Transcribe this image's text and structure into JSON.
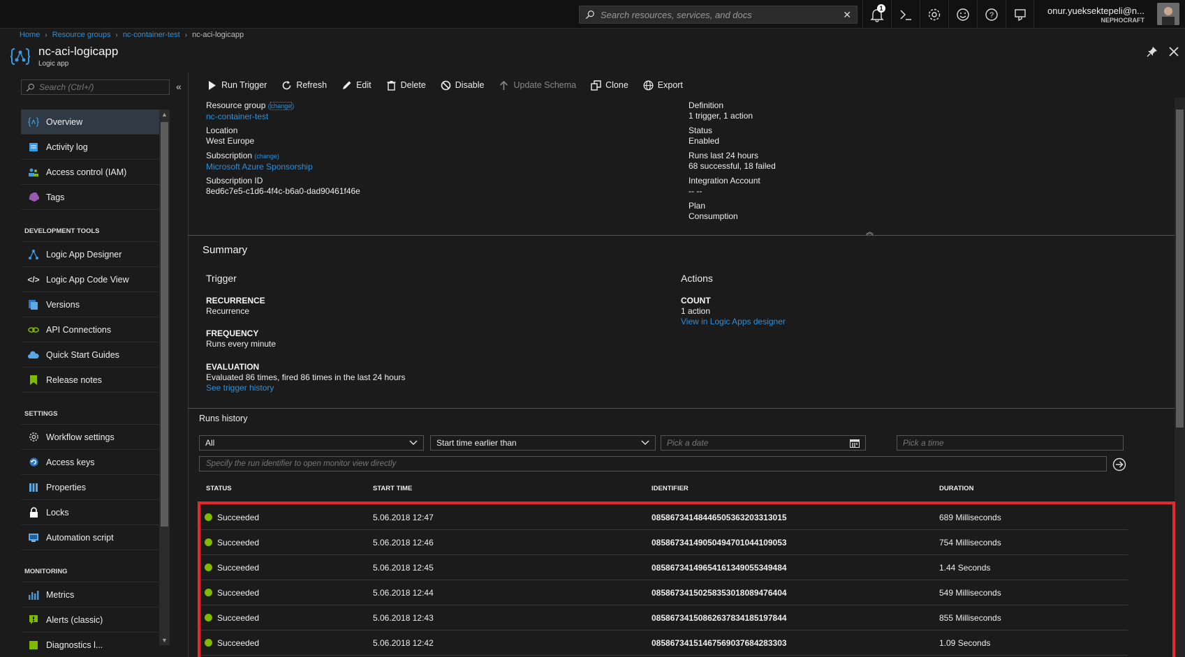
{
  "topbar": {
    "search_placeholder": "Search resources, services, and docs",
    "notification_count": "1",
    "user_name": "onur.yueksektepeli@n...",
    "user_org": "NEPHOCRAFT"
  },
  "breadcrumb": [
    "Home",
    "Resource groups",
    "nc-container-test",
    "nc-aci-logicapp"
  ],
  "blade": {
    "title": "nc-aci-logicapp",
    "subtitle": "Logic app"
  },
  "sidebar": {
    "search_placeholder": "Search (Ctrl+/)",
    "items": [
      {
        "label": "Overview",
        "icon": "logic-app-icon"
      },
      {
        "label": "Activity log",
        "icon": "activity-log-icon"
      },
      {
        "label": "Access control (IAM)",
        "icon": "iam-icon"
      },
      {
        "label": "Tags",
        "icon": "tag-icon"
      }
    ],
    "section_dev": "DEVELOPMENT TOOLS",
    "dev_items": [
      {
        "label": "Logic App Designer",
        "icon": "designer-icon"
      },
      {
        "label": "Logic App Code View",
        "icon": "code-icon"
      },
      {
        "label": "Versions",
        "icon": "versions-icon"
      },
      {
        "label": "API Connections",
        "icon": "api-connections-icon"
      },
      {
        "label": "Quick Start Guides",
        "icon": "cloud-icon"
      },
      {
        "label": "Release notes",
        "icon": "bookmark-icon"
      }
    ],
    "section_settings": "SETTINGS",
    "settings_items": [
      {
        "label": "Workflow settings",
        "icon": "gear-icon"
      },
      {
        "label": "Access keys",
        "icon": "key-icon"
      },
      {
        "label": "Properties",
        "icon": "properties-icon"
      },
      {
        "label": "Locks",
        "icon": "lock-icon"
      },
      {
        "label": "Automation script",
        "icon": "script-icon"
      }
    ],
    "section_monitoring": "MONITORING",
    "monitoring_items": [
      {
        "label": "Metrics",
        "icon": "metrics-icon"
      },
      {
        "label": "Alerts (classic)",
        "icon": "alert-icon"
      },
      {
        "label": "Diagnostics l...",
        "icon": "diagnostics-icon"
      }
    ]
  },
  "commands": {
    "run_trigger": "Run Trigger",
    "refresh": "Refresh",
    "edit": "Edit",
    "delete": "Delete",
    "disable": "Disable",
    "update_schema": "Update Schema",
    "clone": "Clone",
    "export": "Export"
  },
  "essentials": {
    "resource_group_label": "Resource group",
    "change": "change",
    "resource_group_value": "nc-container-test",
    "location_label": "Location",
    "location_value": "West Europe",
    "subscription_label": "Subscription",
    "subscription_value": "Microsoft Azure Sponsorship",
    "subscription_id_label": "Subscription ID",
    "subscription_id_value": "8ed6c7e5-c1d6-4f4c-b6a0-dad90461f46e",
    "definition_label": "Definition",
    "definition_value": "1 trigger, 1 action",
    "status_label": "Status",
    "status_value": "Enabled",
    "runs_label": "Runs last 24 hours",
    "runs_value": "68 successful, 18 failed",
    "integration_label": "Integration Account",
    "integration_value": "-- --",
    "plan_label": "Plan",
    "plan_value": "Consumption"
  },
  "summary": {
    "title": "Summary",
    "trigger_head": "Trigger",
    "recurrence_k": "RECURRENCE",
    "recurrence_v": "Recurrence",
    "frequency_k": "FREQUENCY",
    "frequency_v": "Runs every minute",
    "evaluation_k": "EVALUATION",
    "evaluation_v": "Evaluated 86 times, fired 86 times in the last 24 hours",
    "trigger_history_link": "See trigger history",
    "actions_head": "Actions",
    "count_k": "COUNT",
    "count_v": "1 action",
    "designer_link": "View in Logic Apps designer"
  },
  "runs": {
    "title": "Runs history",
    "status_filter": "All",
    "time_filter": "Start time earlier than",
    "date_placeholder": "Pick a date",
    "time_placeholder": "Pick a time",
    "run_id_placeholder": "Specify the run identifier to open monitor view directly",
    "columns": [
      "STATUS",
      "START TIME",
      "IDENTIFIER",
      "DURATION"
    ],
    "rows": [
      {
        "status": "Succeeded",
        "start": "5.06.2018 12:47",
        "id": "08586734148446505363203313015",
        "duration": "689 Milliseconds"
      },
      {
        "status": "Succeeded",
        "start": "5.06.2018 12:46",
        "id": "08586734149050494701044109053",
        "duration": "754 Milliseconds"
      },
      {
        "status": "Succeeded",
        "start": "5.06.2018 12:45",
        "id": "08586734149654161349055349484",
        "duration": "1.44 Seconds"
      },
      {
        "status": "Succeeded",
        "start": "5.06.2018 12:44",
        "id": "08586734150258353018089476404",
        "duration": "549 Milliseconds"
      },
      {
        "status": "Succeeded",
        "start": "5.06.2018 12:43",
        "id": "08586734150862637834185197844",
        "duration": "855 Milliseconds"
      },
      {
        "status": "Succeeded",
        "start": "5.06.2018 12:42",
        "id": "08586734151467569037684283303",
        "duration": "1.09 Seconds"
      }
    ]
  },
  "colors": {
    "accent": "#2e8fd8",
    "success": "#7fba00",
    "highlight": "#e8262d"
  }
}
